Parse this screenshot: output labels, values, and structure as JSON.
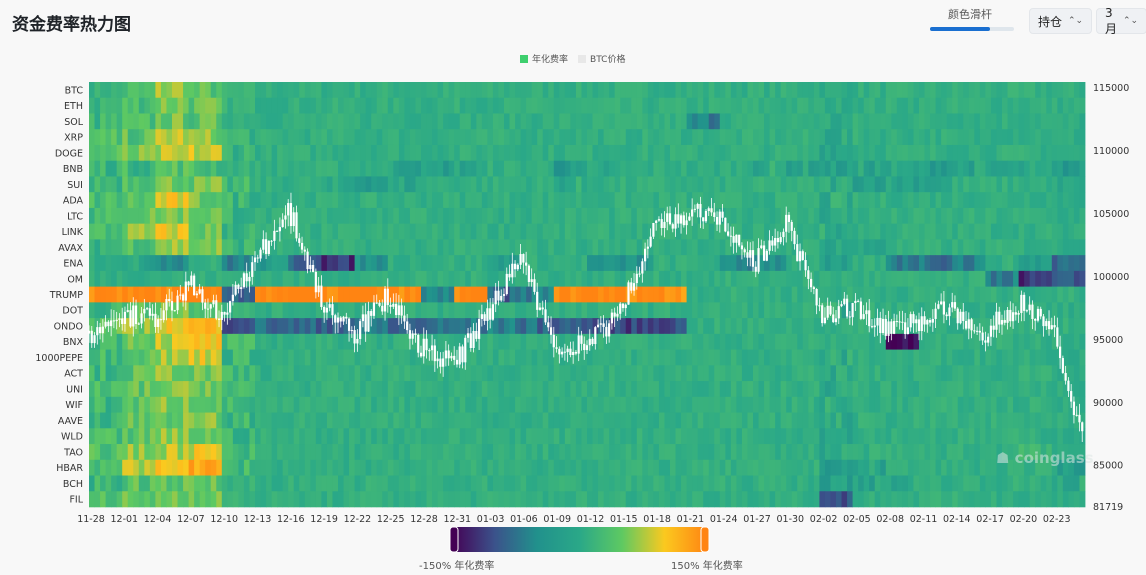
{
  "header": {
    "title": "资金费率热力图",
    "slider_label": "颜色滑杆",
    "slider_value": 0.62,
    "select_metric": "持仓",
    "select_range": "3月"
  },
  "legend": [
    {
      "label": "年化费率",
      "color": "#3ecf6e"
    },
    {
      "label": "BTC价格",
      "color": "#e8e8e8"
    }
  ],
  "colorbar": {
    "min_label": "-150% 年化费率",
    "max_label": "150% 年化费率",
    "min": -150,
    "max": 150,
    "stops": [
      "#440154",
      "#3b528b",
      "#21918c",
      "#2aa888",
      "#5ec962",
      "#fbc91f",
      "#ff8412"
    ]
  },
  "watermark": "coinglass",
  "chart_data": {
    "type": "heatmap",
    "x_ticks": [
      "11-28",
      "12-01",
      "12-04",
      "12-07",
      "12-10",
      "12-13",
      "12-16",
      "12-19",
      "12-22",
      "12-25",
      "12-28",
      "12-31",
      "01-03",
      "01-06",
      "01-09",
      "01-12",
      "01-15",
      "01-18",
      "01-21",
      "01-24",
      "01-27",
      "01-30",
      "02-02",
      "02-05",
      "02-08",
      "02-11",
      "02-14",
      "02-17",
      "02-20",
      "02-23"
    ],
    "rows": [
      "BTC",
      "ETH",
      "SOL",
      "XRP",
      "DOGE",
      "BNB",
      "SUI",
      "ADA",
      "LTC",
      "LINK",
      "AVAX",
      "ENA",
      "OM",
      "TRUMP",
      "DOT",
      "ONDO",
      "BNX",
      "1000PEPE",
      "ACT",
      "UNI",
      "WIF",
      "AAVE",
      "WLD",
      "TAO",
      "HBAR",
      "BCH",
      "FIL"
    ],
    "values": [
      [
        15,
        30,
        70,
        40,
        15,
        10,
        10,
        10,
        10,
        10,
        10,
        10,
        10,
        10,
        10,
        10,
        10,
        10,
        10,
        10,
        10,
        10,
        5,
        10,
        10,
        10,
        10,
        10,
        10,
        8
      ],
      [
        20,
        35,
        60,
        45,
        15,
        10,
        10,
        10,
        10,
        10,
        10,
        10,
        10,
        10,
        10,
        10,
        10,
        10,
        10,
        10,
        10,
        10,
        5,
        10,
        10,
        10,
        10,
        10,
        10,
        8
      ],
      [
        20,
        30,
        50,
        40,
        15,
        10,
        10,
        10,
        10,
        10,
        10,
        10,
        10,
        10,
        10,
        10,
        10,
        10,
        -60,
        10,
        10,
        10,
        0,
        10,
        10,
        10,
        10,
        10,
        10,
        5
      ],
      [
        30,
        40,
        80,
        60,
        20,
        10,
        10,
        10,
        10,
        10,
        10,
        10,
        10,
        10,
        10,
        10,
        10,
        10,
        10,
        10,
        10,
        10,
        0,
        10,
        10,
        10,
        5,
        10,
        10,
        5
      ],
      [
        35,
        50,
        70,
        80,
        20,
        10,
        10,
        10,
        10,
        10,
        10,
        10,
        10,
        10,
        10,
        10,
        10,
        10,
        10,
        10,
        10,
        10,
        0,
        10,
        10,
        10,
        10,
        10,
        10,
        5
      ],
      [
        20,
        25,
        40,
        30,
        15,
        10,
        10,
        10,
        10,
        -10,
        -20,
        -10,
        10,
        10,
        -30,
        -10,
        5,
        10,
        5,
        10,
        0,
        -10,
        -20,
        -10,
        -10,
        -20,
        -10,
        -20,
        -10,
        -30
      ],
      [
        25,
        45,
        55,
        50,
        20,
        10,
        10,
        -10,
        -20,
        -10,
        10,
        10,
        10,
        10,
        0,
        10,
        10,
        10,
        5,
        10,
        10,
        10,
        0,
        -10,
        -10,
        -10,
        10,
        10,
        10,
        -10
      ],
      [
        30,
        40,
        90,
        50,
        20,
        10,
        10,
        10,
        10,
        10,
        10,
        10,
        10,
        10,
        10,
        10,
        10,
        10,
        10,
        10,
        10,
        10,
        0,
        10,
        10,
        10,
        10,
        10,
        10,
        5
      ],
      [
        25,
        50,
        60,
        55,
        20,
        10,
        10,
        10,
        10,
        10,
        10,
        10,
        10,
        10,
        10,
        10,
        10,
        10,
        10,
        10,
        10,
        10,
        0,
        10,
        10,
        10,
        10,
        10,
        10,
        5
      ],
      [
        30,
        60,
        90,
        50,
        20,
        10,
        10,
        10,
        10,
        10,
        10,
        10,
        10,
        10,
        10,
        10,
        10,
        10,
        10,
        10,
        10,
        10,
        0,
        10,
        10,
        10,
        10,
        10,
        10,
        5
      ],
      [
        20,
        40,
        70,
        60,
        20,
        10,
        10,
        10,
        10,
        10,
        10,
        10,
        10,
        10,
        10,
        10,
        10,
        10,
        10,
        10,
        10,
        10,
        0,
        -10,
        10,
        10,
        10,
        10,
        10,
        5
      ],
      [
        10,
        -10,
        -40,
        10,
        -60,
        -30,
        -80,
        -120,
        -40,
        10,
        10,
        10,
        -20,
        10,
        10,
        -50,
        -40,
        10,
        10,
        -60,
        -40,
        10,
        -30,
        10,
        -60,
        -70,
        -60,
        10,
        -20,
        -80
      ],
      [
        10,
        10,
        10,
        10,
        10,
        10,
        10,
        10,
        10,
        10,
        10,
        10,
        10,
        10,
        10,
        10,
        10,
        10,
        10,
        10,
        10,
        10,
        10,
        10,
        10,
        10,
        10,
        -60,
        -120,
        -100
      ],
      [
        150,
        150,
        150,
        150,
        -80,
        150,
        150,
        150,
        150,
        150,
        -60,
        150,
        -90,
        -60,
        150,
        150,
        150,
        140,
        10,
        10,
        10,
        10,
        10,
        10,
        10,
        10,
        10,
        10,
        10,
        10
      ],
      [
        20,
        40,
        60,
        50,
        15,
        10,
        10,
        10,
        10,
        10,
        10,
        10,
        10,
        10,
        10,
        10,
        10,
        10,
        10,
        10,
        10,
        10,
        0,
        10,
        10,
        10,
        10,
        10,
        10,
        5
      ],
      [
        40,
        60,
        100,
        110,
        -90,
        -80,
        -90,
        -80,
        -70,
        -90,
        -80,
        -70,
        -60,
        -80,
        -90,
        -100,
        -110,
        -100,
        10,
        10,
        10,
        10,
        10,
        10,
        10,
        10,
        10,
        10,
        10,
        10
      ],
      [
        30,
        60,
        80,
        100,
        20,
        10,
        10,
        10,
        10,
        10,
        10,
        10,
        10,
        10,
        10,
        10,
        10,
        10,
        10,
        10,
        10,
        10,
        10,
        10,
        -150,
        10,
        10,
        10,
        10,
        10
      ],
      [
        30,
        50,
        70,
        90,
        20,
        10,
        10,
        10,
        10,
        10,
        10,
        10,
        10,
        10,
        10,
        10,
        10,
        10,
        10,
        10,
        10,
        10,
        0,
        10,
        10,
        10,
        10,
        10,
        10,
        5
      ],
      [
        25,
        40,
        60,
        50,
        20,
        10,
        10,
        10,
        10,
        10,
        10,
        10,
        10,
        10,
        10,
        10,
        10,
        10,
        10,
        10,
        10,
        10,
        0,
        10,
        10,
        10,
        10,
        10,
        10,
        5
      ],
      [
        25,
        45,
        55,
        60,
        20,
        10,
        10,
        10,
        10,
        10,
        10,
        10,
        10,
        10,
        10,
        10,
        10,
        10,
        10,
        10,
        10,
        10,
        0,
        10,
        10,
        10,
        10,
        10,
        10,
        5
      ],
      [
        20,
        40,
        60,
        55,
        20,
        10,
        10,
        10,
        10,
        10,
        10,
        10,
        10,
        10,
        10,
        10,
        10,
        10,
        10,
        10,
        10,
        10,
        0,
        10,
        10,
        10,
        10,
        10,
        10,
        5
      ],
      [
        25,
        45,
        55,
        55,
        20,
        10,
        10,
        10,
        10,
        10,
        10,
        10,
        10,
        10,
        10,
        10,
        10,
        10,
        10,
        10,
        10,
        10,
        0,
        10,
        10,
        10,
        10,
        10,
        10,
        5
      ],
      [
        25,
        40,
        60,
        50,
        20,
        10,
        10,
        10,
        10,
        10,
        10,
        10,
        10,
        10,
        10,
        10,
        10,
        10,
        10,
        10,
        10,
        10,
        0,
        10,
        10,
        10,
        10,
        10,
        10,
        5
      ],
      [
        35,
        60,
        80,
        90,
        20,
        10,
        10,
        10,
        10,
        10,
        10,
        10,
        10,
        10,
        10,
        10,
        10,
        10,
        10,
        10,
        10,
        10,
        0,
        10,
        10,
        10,
        10,
        10,
        30,
        5
      ],
      [
        40,
        70,
        110,
        120,
        25,
        10,
        10,
        10,
        10,
        10,
        10,
        10,
        10,
        10,
        10,
        10,
        10,
        10,
        10,
        10,
        10,
        10,
        -20,
        -10,
        10,
        10,
        10,
        10,
        10,
        -20
      ],
      [
        20,
        40,
        50,
        40,
        15,
        10,
        10,
        10,
        10,
        10,
        10,
        10,
        10,
        10,
        10,
        10,
        10,
        10,
        10,
        10,
        10,
        10,
        -20,
        -10,
        0,
        10,
        10,
        10,
        10,
        0
      ],
      [
        30,
        45,
        55,
        60,
        15,
        10,
        10,
        10,
        10,
        10,
        10,
        10,
        10,
        10,
        10,
        10,
        10,
        10,
        10,
        10,
        10,
        10,
        -100,
        10,
        10,
        10,
        10,
        10,
        10,
        5
      ]
    ],
    "btc_price": [
      95500,
      97000,
      96500,
      99500,
      97000,
      101000,
      105500,
      98000,
      95500,
      98500,
      94500,
      93000,
      97000,
      101500,
      94500,
      94500,
      97000,
      104000,
      105000,
      105000,
      101000,
      104500,
      97000,
      97500,
      96000,
      96500,
      97500,
      95500,
      98000,
      96000
    ],
    "btc_price_end": 86500,
    "y_right_ticks": [
      115000,
      110000,
      105000,
      100000,
      95000,
      90000,
      85000,
      81719
    ],
    "y_right_range": [
      81719,
      115480
    ],
    "colorbar_range": [
      -150,
      150
    ]
  }
}
